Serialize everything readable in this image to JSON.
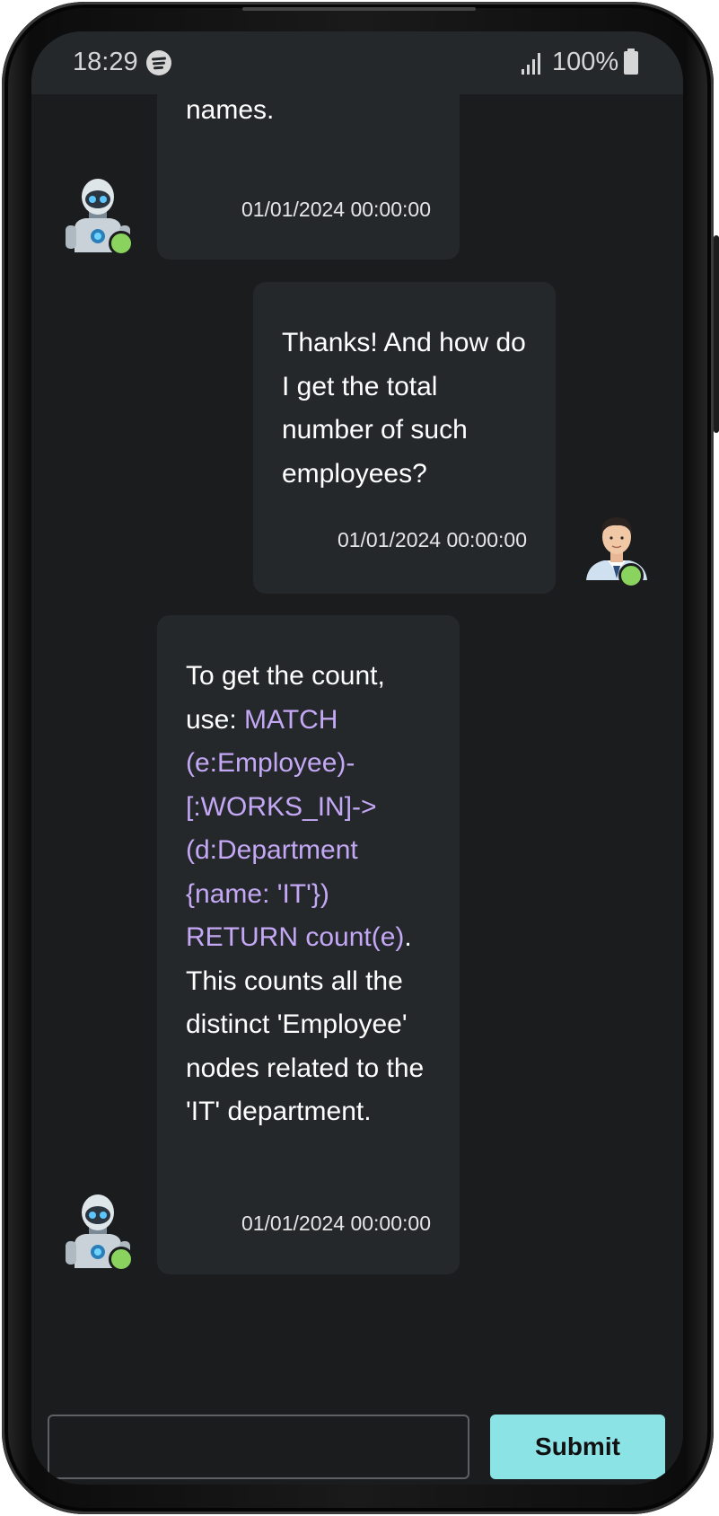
{
  "status_bar": {
    "time": "18:29",
    "battery_text": "100%",
    "icons": [
      "spotify-icon",
      "signal-icon",
      "battery-icon"
    ]
  },
  "messages": [
    {
      "sender": "bot",
      "avatar": "robot-avatar",
      "segments": [
        {
          "text": "names.",
          "code": false
        }
      ],
      "timestamp": "01/01/2024 00:00:00",
      "online": true
    },
    {
      "sender": "user",
      "avatar": "user-avatar",
      "segments": [
        {
          "text": "Thanks! And how do I get the total number of such employees?",
          "code": false
        }
      ],
      "timestamp": "01/01/2024 00:00:00",
      "online": true
    },
    {
      "sender": "bot",
      "avatar": "robot-avatar",
      "segments": [
        {
          "text": "To get the count, use: ",
          "code": false
        },
        {
          "text": "MATCH (e:Employee)-[:WORKS_IN]->(d:Department {name: 'IT'}) RETURN count(e)",
          "code": true
        },
        {
          "text": ". This counts all the distinct 'Employee' nodes related to the 'IT' department.",
          "code": false
        }
      ],
      "timestamp": "01/01/2024 00:00:00",
      "online": true
    }
  ],
  "input": {
    "value": "",
    "placeholder": "",
    "submit_label": "Submit"
  },
  "colors": {
    "background": "#1b1c1e",
    "bubble": "#24282b",
    "code_text": "#c4a8f5",
    "submit_button": "#8ce3e6",
    "online_dot": "#8bd35f"
  }
}
